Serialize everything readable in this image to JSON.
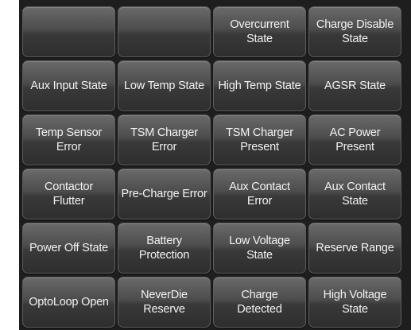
{
  "tiles": [
    {
      "name": "blank-tile-1",
      "label": ""
    },
    {
      "name": "blank-tile-2",
      "label": ""
    },
    {
      "name": "overcurrent-state-tile",
      "label": "Overcurrent\nState"
    },
    {
      "name": "charge-disable-state-tile",
      "label": "Charge Disable\nState"
    },
    {
      "name": "aux-input-state-tile",
      "label": "Aux Input State"
    },
    {
      "name": "low-temp-state-tile",
      "label": "Low Temp State"
    },
    {
      "name": "high-temp-state-tile",
      "label": "High Temp State"
    },
    {
      "name": "agsr-state-tile",
      "label": "AGSR State"
    },
    {
      "name": "temp-sensor-error-tile",
      "label": "Temp Sensor\nError"
    },
    {
      "name": "tsm-charger-error-tile",
      "label": "TSM Charger\nError"
    },
    {
      "name": "tsm-charger-present-tile",
      "label": "TSM Charger\nPresent"
    },
    {
      "name": "ac-power-present-tile",
      "label": "AC Power\nPresent"
    },
    {
      "name": "contactor-flutter-tile",
      "label": "Contactor\nFlutter"
    },
    {
      "name": "pre-charge-error-tile",
      "label": "Pre-Charge Error"
    },
    {
      "name": "aux-contact-error-tile",
      "label": "Aux Contact\nError"
    },
    {
      "name": "aux-contact-state-tile",
      "label": "Aux Contact\nState"
    },
    {
      "name": "power-off-state-tile",
      "label": "Power Off State"
    },
    {
      "name": "battery-protection-tile",
      "label": "Battery\nProtection"
    },
    {
      "name": "low-voltage-state-tile",
      "label": "Low Voltage\nState"
    },
    {
      "name": "reserve-range-tile",
      "label": "Reserve Range"
    },
    {
      "name": "optoloop-open-tile",
      "label": "OptoLoop Open"
    },
    {
      "name": "neverdie-reserve-tile",
      "label": "NeverDie\nReserve"
    },
    {
      "name": "charge-detected-tile",
      "label": "Charge\nDetected"
    },
    {
      "name": "high-voltage-state-tile",
      "label": "High Voltage\nState"
    }
  ]
}
